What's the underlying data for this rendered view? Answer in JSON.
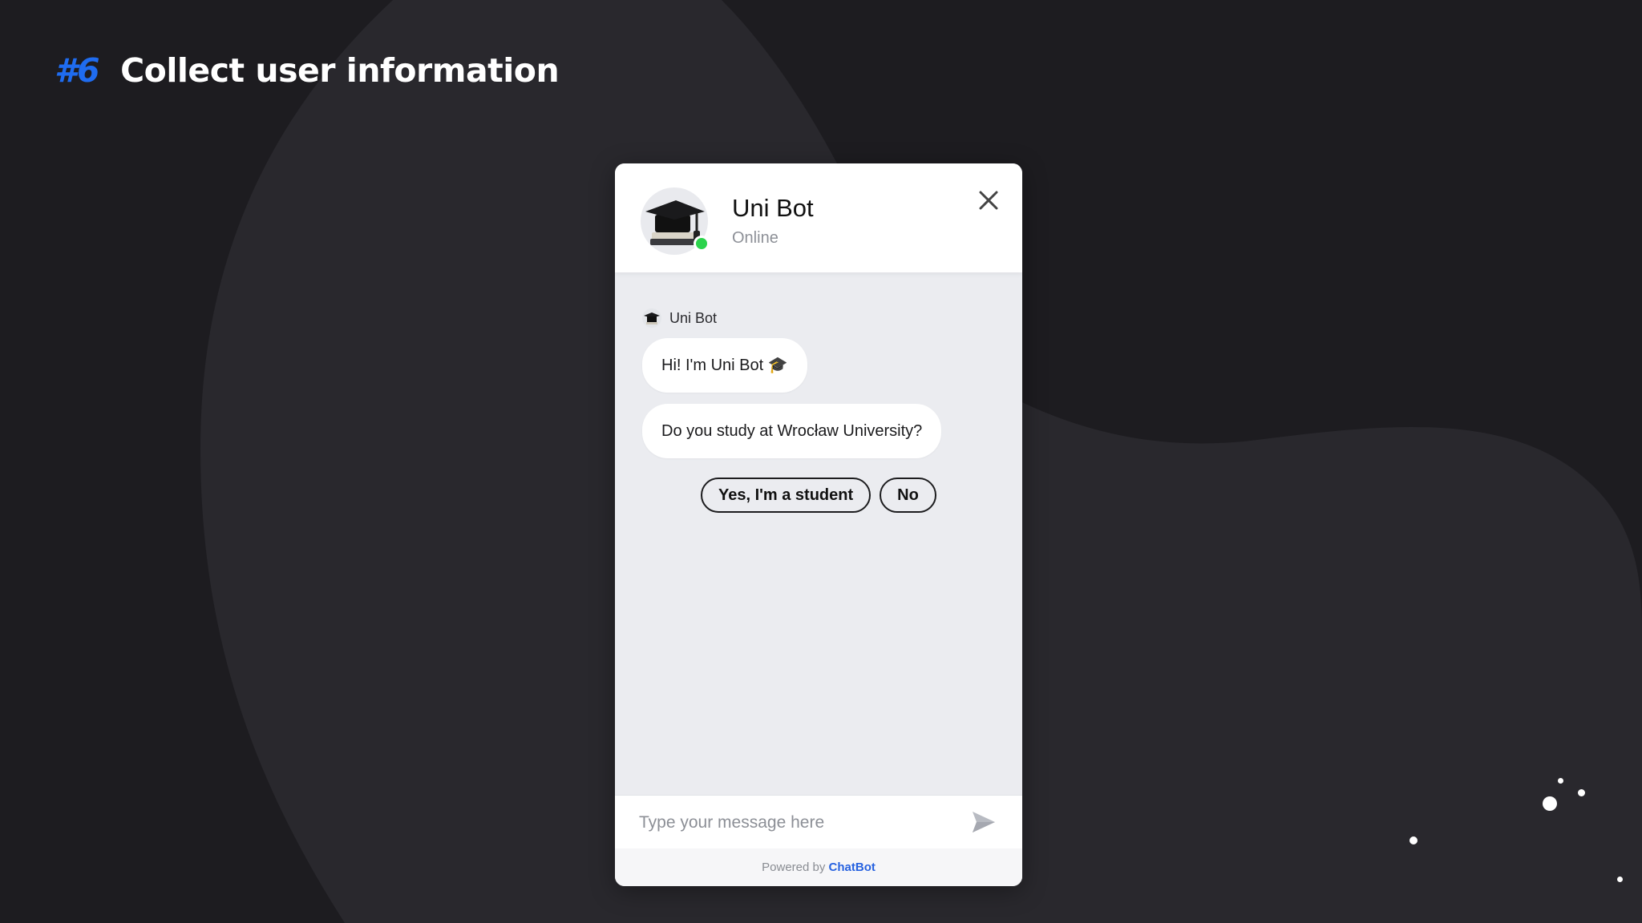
{
  "slide": {
    "number": "#6",
    "title": "Collect user information"
  },
  "widget": {
    "bot_name": "Uni Bot",
    "status": "Online",
    "sender_label": "Uni Bot",
    "messages": [
      "Hi! I'm Uni Bot 🎓",
      "Do you study at Wrocław University?"
    ],
    "quick_replies": [
      "Yes, I'm a student",
      "No"
    ],
    "input_placeholder": "Type your message here",
    "footer_prefix": "Powered by",
    "footer_brand": "ChatBot"
  },
  "colors": {
    "background": "#1d1c20",
    "accent_number": "#1f6cf0",
    "online_dot": "#2bd34c",
    "brand_link": "#2762e0"
  },
  "icons": {
    "avatar": "graduation-cap-books",
    "close": "close-x",
    "send": "paper-plane"
  }
}
